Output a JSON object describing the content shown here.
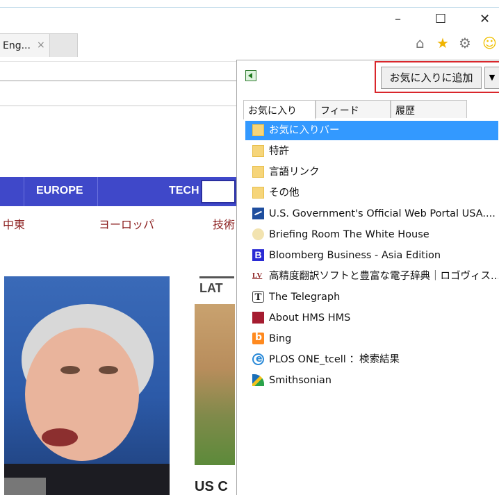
{
  "window": {
    "minimize_glyph": "–",
    "maximize_glyph": "☐",
    "close_glyph": "✕"
  },
  "browser_tab": {
    "title": "Eng...",
    "close_glyph": "×"
  },
  "toolbar_icons": [
    "home-icon",
    "favorites-star-icon",
    "settings-gear-icon",
    "feedback-smiley-icon"
  ],
  "webpage": {
    "nav": [
      "EUROPE",
      "TECH"
    ],
    "nav_jp": [
      "中東",
      "ヨーロッパ",
      "技術"
    ],
    "latest_heading": "LAT",
    "headline_fragment": "US C"
  },
  "favorites_panel": {
    "add_button": "お気に入りに追加",
    "dropdown_glyph": "▼",
    "tabs": [
      "お気に入り",
      "フィード",
      "履歴"
    ],
    "active_tab": "お気に入り",
    "items": [
      {
        "label": "お気に入りバー",
        "icon": "folder-icon",
        "selected": true
      },
      {
        "label": "特許",
        "icon": "folder-icon",
        "selected": false
      },
      {
        "label": "言語リンク",
        "icon": "folder-icon",
        "selected": false
      },
      {
        "label": "その他",
        "icon": "folder-icon",
        "selected": false
      },
      {
        "label": "U.S. Government's Official Web Portal  USA....",
        "icon": "usa-gov-icon",
        "selected": false
      },
      {
        "label": "Briefing Room  The White House",
        "icon": "white-house-seal-icon",
        "selected": false
      },
      {
        "label": "Bloomberg Business - Asia Edition",
        "icon": "bloomberg-icon",
        "selected": false
      },
      {
        "label": "高精度翻訳ソフトと豊富な電子辞典｜ロゴヴィス...",
        "icon": "logovista-icon",
        "selected": false
      },
      {
        "label": "The Telegraph",
        "icon": "telegraph-icon",
        "selected": false
      },
      {
        "label": "About HMS  HMS",
        "icon": "hms-icon",
        "selected": false
      },
      {
        "label": "Bing",
        "icon": "bing-icon",
        "selected": false
      },
      {
        "label": "PLOS ONE_tcell ：検索結果",
        "icon": "ie-page-icon",
        "selected": false
      },
      {
        "label": "Smithsonian",
        "icon": "smithsonian-icon",
        "selected": false
      }
    ]
  }
}
